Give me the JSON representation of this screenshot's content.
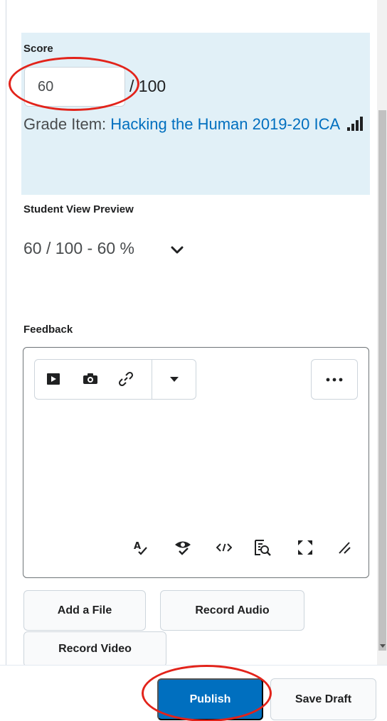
{
  "score": {
    "label": "Score",
    "value": "60",
    "out_of": "/ 100",
    "grade_item_prefix": "Grade Item: ",
    "grade_item_link": "Hacking the Human 2019-20 ICA",
    "stats_icon": "bar-chart-icon"
  },
  "student_view_preview": {
    "label": "Student View Preview",
    "value": "60 / 100 - 60 %",
    "expand_icon": "chevron-down-icon"
  },
  "feedback": {
    "label": "Feedback",
    "toolbar": {
      "icons": [
        "video-icon",
        "camera-icon",
        "link-icon",
        "caret-down-icon",
        "more-icon"
      ],
      "bottom_icons": [
        "spellcheck-icon",
        "accessibility-icon",
        "source-code-icon",
        "preview-icon",
        "fullscreen-icon",
        "resize-icon"
      ]
    }
  },
  "attachments": {
    "add_file": "Add a File",
    "record_audio": "Record Audio",
    "record_video": "Record Video"
  },
  "footer": {
    "publish": "Publish",
    "save_draft": "Save Draft"
  },
  "colors": {
    "accent": "#006fbf",
    "panel_bg": "#e1f0f7",
    "annotation": "#e2231a"
  }
}
